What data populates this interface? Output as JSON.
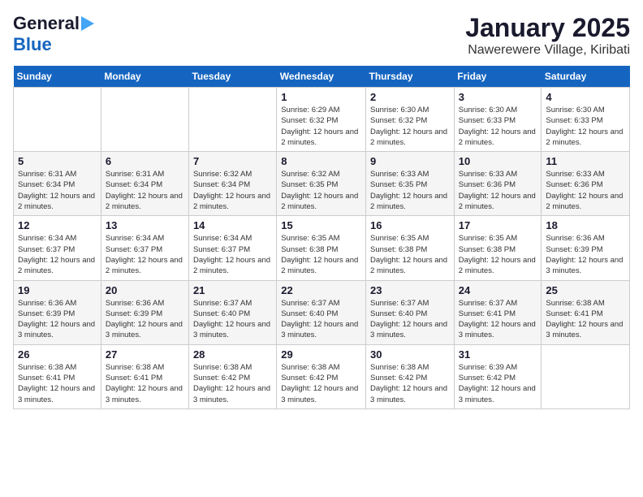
{
  "logo": {
    "line1": "General",
    "line2": "Blue"
  },
  "title": "January 2025",
  "subtitle": "Nawerewere Village, Kiribati",
  "days_header": [
    "Sunday",
    "Monday",
    "Tuesday",
    "Wednesday",
    "Thursday",
    "Friday",
    "Saturday"
  ],
  "weeks": [
    [
      {
        "num": "",
        "info": ""
      },
      {
        "num": "",
        "info": ""
      },
      {
        "num": "",
        "info": ""
      },
      {
        "num": "1",
        "info": "Sunrise: 6:29 AM\nSunset: 6:32 PM\nDaylight: 12 hours and 2 minutes."
      },
      {
        "num": "2",
        "info": "Sunrise: 6:30 AM\nSunset: 6:32 PM\nDaylight: 12 hours and 2 minutes."
      },
      {
        "num": "3",
        "info": "Sunrise: 6:30 AM\nSunset: 6:33 PM\nDaylight: 12 hours and 2 minutes."
      },
      {
        "num": "4",
        "info": "Sunrise: 6:30 AM\nSunset: 6:33 PM\nDaylight: 12 hours and 2 minutes."
      }
    ],
    [
      {
        "num": "5",
        "info": "Sunrise: 6:31 AM\nSunset: 6:34 PM\nDaylight: 12 hours and 2 minutes."
      },
      {
        "num": "6",
        "info": "Sunrise: 6:31 AM\nSunset: 6:34 PM\nDaylight: 12 hours and 2 minutes."
      },
      {
        "num": "7",
        "info": "Sunrise: 6:32 AM\nSunset: 6:34 PM\nDaylight: 12 hours and 2 minutes."
      },
      {
        "num": "8",
        "info": "Sunrise: 6:32 AM\nSunset: 6:35 PM\nDaylight: 12 hours and 2 minutes."
      },
      {
        "num": "9",
        "info": "Sunrise: 6:33 AM\nSunset: 6:35 PM\nDaylight: 12 hours and 2 minutes."
      },
      {
        "num": "10",
        "info": "Sunrise: 6:33 AM\nSunset: 6:36 PM\nDaylight: 12 hours and 2 minutes."
      },
      {
        "num": "11",
        "info": "Sunrise: 6:33 AM\nSunset: 6:36 PM\nDaylight: 12 hours and 2 minutes."
      }
    ],
    [
      {
        "num": "12",
        "info": "Sunrise: 6:34 AM\nSunset: 6:37 PM\nDaylight: 12 hours and 2 minutes."
      },
      {
        "num": "13",
        "info": "Sunrise: 6:34 AM\nSunset: 6:37 PM\nDaylight: 12 hours and 2 minutes."
      },
      {
        "num": "14",
        "info": "Sunrise: 6:34 AM\nSunset: 6:37 PM\nDaylight: 12 hours and 2 minutes."
      },
      {
        "num": "15",
        "info": "Sunrise: 6:35 AM\nSunset: 6:38 PM\nDaylight: 12 hours and 2 minutes."
      },
      {
        "num": "16",
        "info": "Sunrise: 6:35 AM\nSunset: 6:38 PM\nDaylight: 12 hours and 2 minutes."
      },
      {
        "num": "17",
        "info": "Sunrise: 6:35 AM\nSunset: 6:38 PM\nDaylight: 12 hours and 2 minutes."
      },
      {
        "num": "18",
        "info": "Sunrise: 6:36 AM\nSunset: 6:39 PM\nDaylight: 12 hours and 3 minutes."
      }
    ],
    [
      {
        "num": "19",
        "info": "Sunrise: 6:36 AM\nSunset: 6:39 PM\nDaylight: 12 hours and 3 minutes."
      },
      {
        "num": "20",
        "info": "Sunrise: 6:36 AM\nSunset: 6:39 PM\nDaylight: 12 hours and 3 minutes."
      },
      {
        "num": "21",
        "info": "Sunrise: 6:37 AM\nSunset: 6:40 PM\nDaylight: 12 hours and 3 minutes."
      },
      {
        "num": "22",
        "info": "Sunrise: 6:37 AM\nSunset: 6:40 PM\nDaylight: 12 hours and 3 minutes."
      },
      {
        "num": "23",
        "info": "Sunrise: 6:37 AM\nSunset: 6:40 PM\nDaylight: 12 hours and 3 minutes."
      },
      {
        "num": "24",
        "info": "Sunrise: 6:37 AM\nSunset: 6:41 PM\nDaylight: 12 hours and 3 minutes."
      },
      {
        "num": "25",
        "info": "Sunrise: 6:38 AM\nSunset: 6:41 PM\nDaylight: 12 hours and 3 minutes."
      }
    ],
    [
      {
        "num": "26",
        "info": "Sunrise: 6:38 AM\nSunset: 6:41 PM\nDaylight: 12 hours and 3 minutes."
      },
      {
        "num": "27",
        "info": "Sunrise: 6:38 AM\nSunset: 6:41 PM\nDaylight: 12 hours and 3 minutes."
      },
      {
        "num": "28",
        "info": "Sunrise: 6:38 AM\nSunset: 6:42 PM\nDaylight: 12 hours and 3 minutes."
      },
      {
        "num": "29",
        "info": "Sunrise: 6:38 AM\nSunset: 6:42 PM\nDaylight: 12 hours and 3 minutes."
      },
      {
        "num": "30",
        "info": "Sunrise: 6:38 AM\nSunset: 6:42 PM\nDaylight: 12 hours and 3 minutes."
      },
      {
        "num": "31",
        "info": "Sunrise: 6:39 AM\nSunset: 6:42 PM\nDaylight: 12 hours and 3 minutes."
      },
      {
        "num": "",
        "info": ""
      }
    ]
  ]
}
